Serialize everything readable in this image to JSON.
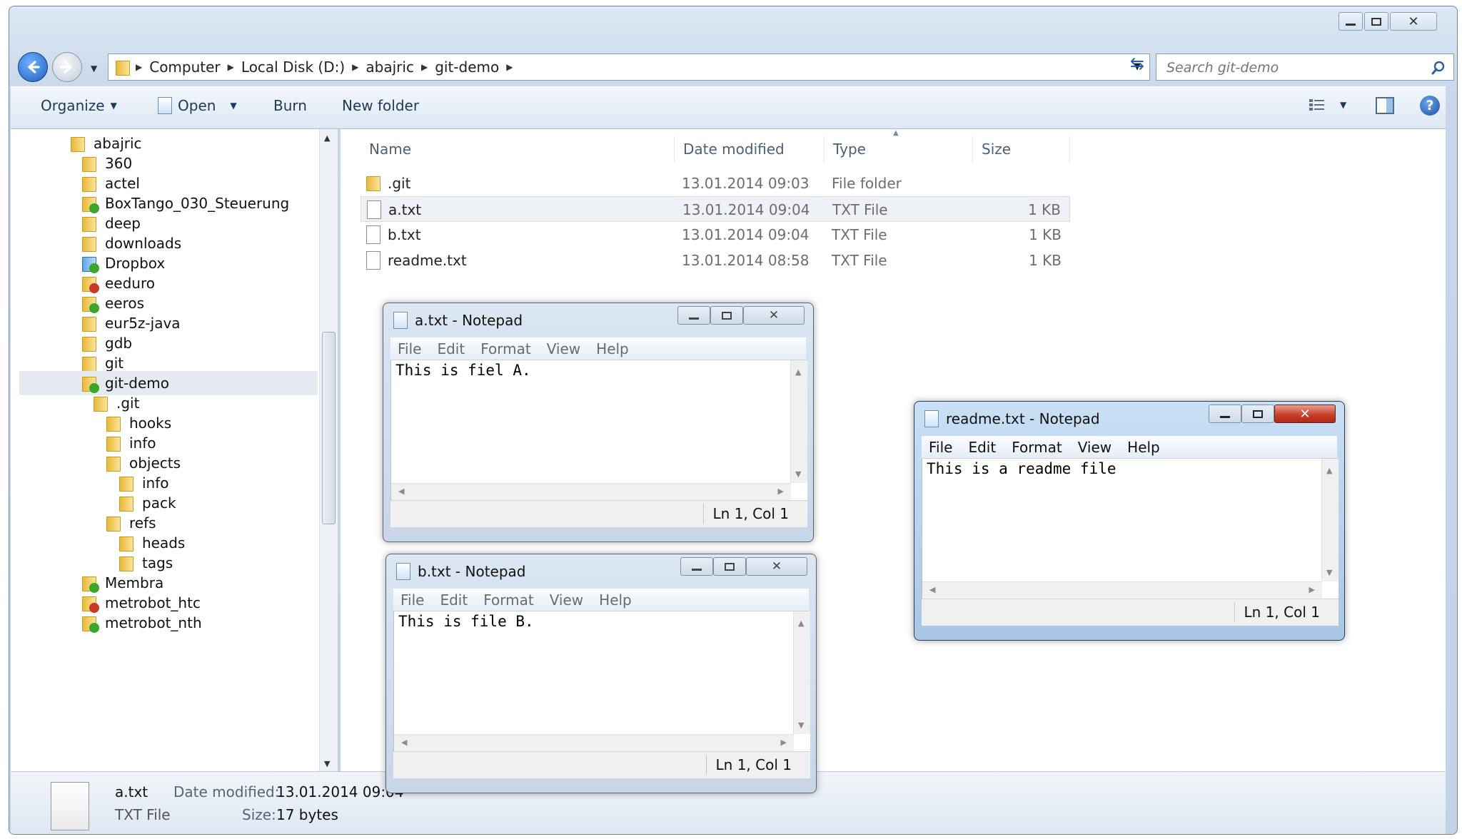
{
  "explorer": {
    "breadcrumb": [
      "Computer",
      "Local Disk (D:)",
      "abajric",
      "git-demo"
    ],
    "search_placeholder": "Search git-demo",
    "toolbar": {
      "organize": "Organize",
      "open": "Open",
      "burn": "Burn",
      "new_folder": "New folder"
    },
    "columns": {
      "name": "Name",
      "date": "Date modified",
      "type": "Type",
      "size": "Size"
    },
    "files": [
      {
        "name": ".git",
        "date": "13.01.2014 09:03",
        "type": "File folder",
        "size": ""
      },
      {
        "name": "a.txt",
        "date": "13.01.2014 09:04",
        "type": "TXT File",
        "size": "1 KB"
      },
      {
        "name": "b.txt",
        "date": "13.01.2014 09:04",
        "type": "TXT File",
        "size": "1 KB"
      },
      {
        "name": "readme.txt",
        "date": "13.01.2014 08:58",
        "type": "TXT File",
        "size": "1 KB"
      }
    ],
    "tree": [
      {
        "label": "abajric",
        "badge": ""
      },
      {
        "label": "360",
        "badge": ""
      },
      {
        "label": "actel",
        "badge": ""
      },
      {
        "label": "BoxTango_030_Steuerung",
        "badge": "green"
      },
      {
        "label": "deep",
        "badge": ""
      },
      {
        "label": "downloads",
        "badge": ""
      },
      {
        "label": "Dropbox",
        "badge": "dropbox"
      },
      {
        "label": "eeduro",
        "badge": "red"
      },
      {
        "label": "eeros",
        "badge": "green"
      },
      {
        "label": "eur5z-java",
        "badge": ""
      },
      {
        "label": "gdb",
        "badge": ""
      },
      {
        "label": "git",
        "badge": ""
      },
      {
        "label": "git-demo",
        "badge": "green"
      },
      {
        "label": ".git",
        "badge": ""
      },
      {
        "label": "hooks",
        "badge": ""
      },
      {
        "label": "info",
        "badge": ""
      },
      {
        "label": "objects",
        "badge": ""
      },
      {
        "label": "info",
        "badge": ""
      },
      {
        "label": "pack",
        "badge": ""
      },
      {
        "label": "refs",
        "badge": ""
      },
      {
        "label": "heads",
        "badge": ""
      },
      {
        "label": "tags",
        "badge": ""
      },
      {
        "label": "Membra",
        "badge": "green"
      },
      {
        "label": "metrobot_htc",
        "badge": "red"
      },
      {
        "label": "metrobot_nth",
        "badge": "green"
      }
    ],
    "details": {
      "name": "a.txt",
      "type": "TXT File",
      "date_label": "Date modified:",
      "date_value": "13.01.2014 09:04",
      "size_label": "Size:",
      "size_value": "17 bytes"
    }
  },
  "notepad_menu": [
    "File",
    "Edit",
    "Format",
    "View",
    "Help"
  ],
  "notepads": {
    "a": {
      "title": "a.txt - Notepad",
      "content": "This is fiel A.",
      "status": "Ln 1, Col 1"
    },
    "b": {
      "title": "b.txt - Notepad",
      "content": "This is file B.",
      "status": "Ln 1, Col 1"
    },
    "readme": {
      "title": "readme.txt - Notepad",
      "content": "This is a readme file",
      "status": "Ln 1, Col 1"
    }
  }
}
